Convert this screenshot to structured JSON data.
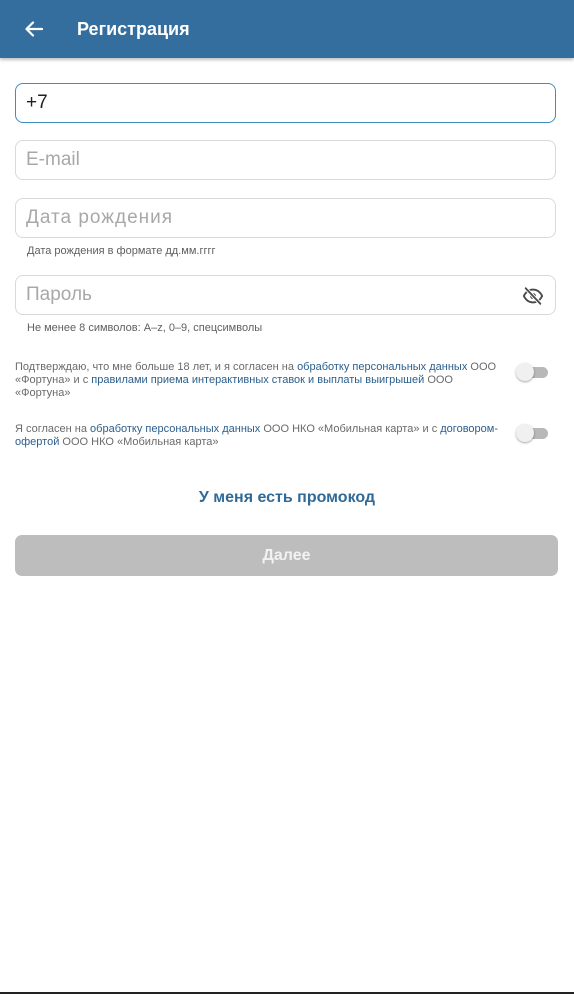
{
  "header": {
    "title": "Регистрация"
  },
  "form": {
    "phone": {
      "value": "+7",
      "placeholder": ""
    },
    "email": {
      "value": "",
      "placeholder": "E-mail"
    },
    "birthdate": {
      "value": "",
      "placeholder": "Дата рождения",
      "hint": "Дата рождения в формате дд.мм.гггг"
    },
    "password": {
      "value": "",
      "placeholder": "Пароль",
      "hint": "Не менее 8 символов: A–z, 0–9, спецсимволы"
    }
  },
  "consents": [
    {
      "t1": "Подтверждаю, что мне больше 18 лет, и я согласен на ",
      "l1": "обработку персональных данных",
      "t2": " ООО «Фортуна» и с ",
      "l2": "правилами приема интерактивных ставок и выплаты выигрышей",
      "t3": " ООО «Фортуна»",
      "checked": false
    },
    {
      "t1": "Я согласен на ",
      "l1": "обработку персональных данных",
      "t2": " ООО НКО «Мобильная карта» и с ",
      "l2": "договором-офертой",
      "t3": " ООО НКО «Мобильная карта»",
      "checked": false
    }
  ],
  "promo_label": "У меня есть промокод",
  "next_label": "Далее",
  "colors": {
    "appbar": "#336e9f",
    "link": "#2b5e8c",
    "button_disabled": "#bdbdbd",
    "focus_border": "#3d8fbd"
  },
  "icons": {
    "back": "arrow-left-icon",
    "password_visibility": "eye-off-icon"
  }
}
